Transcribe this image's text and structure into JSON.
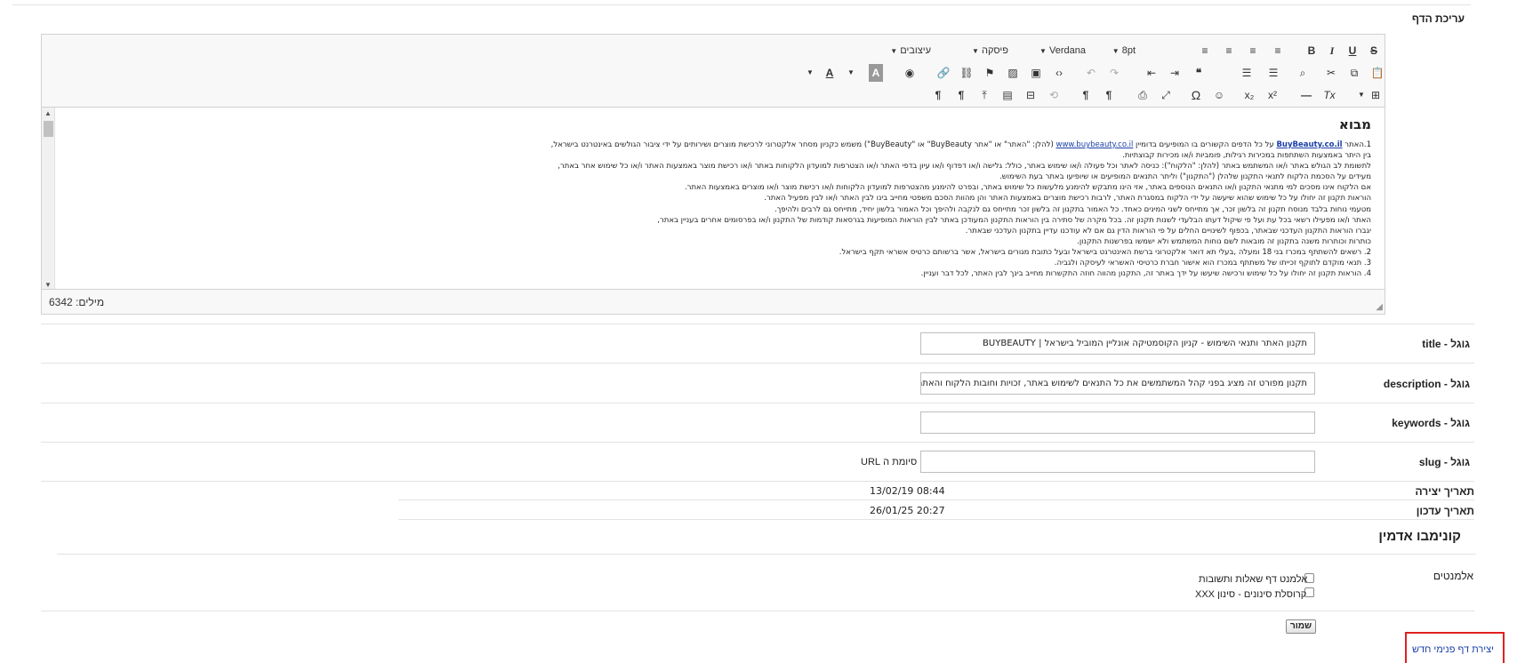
{
  "page": {
    "edit_label": "עריכת הדף"
  },
  "editor": {
    "toolbar": {
      "styles_label": "עיצובים",
      "format_label": "פיסקה",
      "font_label": "Verdana",
      "size_label": "8pt"
    },
    "content": {
      "heading": "מבוא",
      "line1_pre": "1.האתר ",
      "line1_link1": "BuyBeauty.co.il",
      "line1_mid": " על כל הדפים הקשורים בו המופיעים בדומיין ",
      "line1_link2": "www.buybeauty.co.il",
      "line1_post": " (להלן: \"האתר\" או \"אתר BuyBeauty\" או \"BuyBeauty\") משמש כקניון מסחר אלקטרוני לרכישת מוצרים ושירותים על ידי ציבור הגולשים באינטרנט בישראל,",
      "lines": [
        "בין היתר באמצעות השתתפות במכירות רגילות, פומביות ו/או מכירות קבוצתיות.",
        "לתשומת לב הגולש באתר ו/או המשתמש באתר (להלן: \"הלקוח\"): כניסה לאתר וכל פעולה ו/או שימוש באתר, כולל: גלישה ו/או דפדוף ו/או עיון בדפי האתר ו/או הצטרפות למועדון הלקוחות באתר ו/או רכישת מוצר באמצעות האתר ו/או כל שימוש אחר באתר,",
        "מעידים על הסכמת הלקוח לתנאי התקנון שלהלן (\"התקנון\") וליתר התנאים המופיעים או שיופיעו באתר בעת השימוש.",
        "אם הלקוח אינו מסכים למי מתנאי התקנון ו/או התנאים הנוספים באתר, אזי הינו מתבקש להימנע מלעשות כל שימוש באתר, ובפרט להימנע מהצטרפות למועדון הלקוחות ו/או רכישת מוצר ו/או מוצרים באמצעות האתר.",
        "הוראות תקנון זה יחולו על כל שימוש שהוא שיעשה על ידי הלקוח במסגרת האתר, לרבות רכישת מוצרים באמצעות האתר והן מהוות הסכם משפטי מחייב בינו לבין האתר ו/או לבין מפעיל האתר.",
        "מטעמי נוחות בלבד מנוסח תקנון זה בלשון זכר, אך מתייחס לשני המינים כאחד. כל האמור בתקנון זה בלשון זכר מתייחס גם לנקבה ולהיפך וכל האמור בלשון יחיד, מתייחס גם לרבים ולהיפך.",
        "האתר ו/או מפעילו רשאי בכל עת ועל פי שיקול דעתו הבלעדי לשנות תקנון זה. בכל מקרה של סתירה בין הוראות התקנון המעודכן באתר לבין הוראות המופיעות בגרסאות קודמות של התקנון ו/או בפרסומים אחרים בעניין באתר,",
        "יגברו הוראות התקנון העדכני שבאתר, בכפוף לשינויים החלים על פי הוראות הדין גם אם לא עודכנו עדיין בתקנון העדכני שבאתר.",
        "כותרות וכותרות משנה בתקנון זה מובאות לשם נוחות המשתמש ולא ישמשו בפרשנות התקנון.",
        "2. רשאים להשתתף במכרז בני 18 ומעלה ,בעלי תא דואר אלקטרוני ברשת האינטרנט בישראל ובעל כתובת מגורים בישראל, אשר ברשותם כרטיס אשראי תקף בישראל.",
        "3. תנאי מוקדם לתוקף זכייתו של משתתף במכרז הוא אישור חברת כרטיסי האשראי לעיסקה ולגביה.",
        "4. הוראות תקנון זה יחולו על כל שימוש ורכישה שיעשו על ידך באתר זה, התקנון מהווה חוזה התקשרות מחייב בינך לבין האתר, לכל דבר ועניין."
      ]
    },
    "word_count_label": "מילים: 6342"
  },
  "google_title": {
    "label": "גוגל - title",
    "value": "תקנון האתר ותנאי השימוש - קניון הקוסמטיקה אונליין המוביל בישראל | BUYBEAUTY"
  },
  "google_description": {
    "label": "גוגל - description",
    "value": "תקנון מפורט זה מציג בפני קהל המשתמשים את כל התנאים לשימוש באתר, זכויות וחובות הלקוח והאתר. התקנו"
  },
  "google_keywords": {
    "label": "גוגל - keywords",
    "value": ""
  },
  "google_slug": {
    "label": "גוגל - slug",
    "value": "",
    "suffix": "סיומת ה URL"
  },
  "created": {
    "label": "תאריך יצירה",
    "value": "13/02/19 08:44"
  },
  "updated": {
    "label": "תאריך עדכון",
    "value": "26/01/25 20:27"
  },
  "admin": {
    "section_title": "קונימבו אדמין",
    "elements_label": "אלמנטים",
    "elements": [
      {
        "label": "אלמנט דף שאלות ותשובות",
        "checked": false
      },
      {
        "label": "קרוסלת סינונים - סינון XXX",
        "checked": false
      }
    ],
    "save_label": "שמור",
    "create_link_label": "יצירת דף פנימי חדש"
  }
}
